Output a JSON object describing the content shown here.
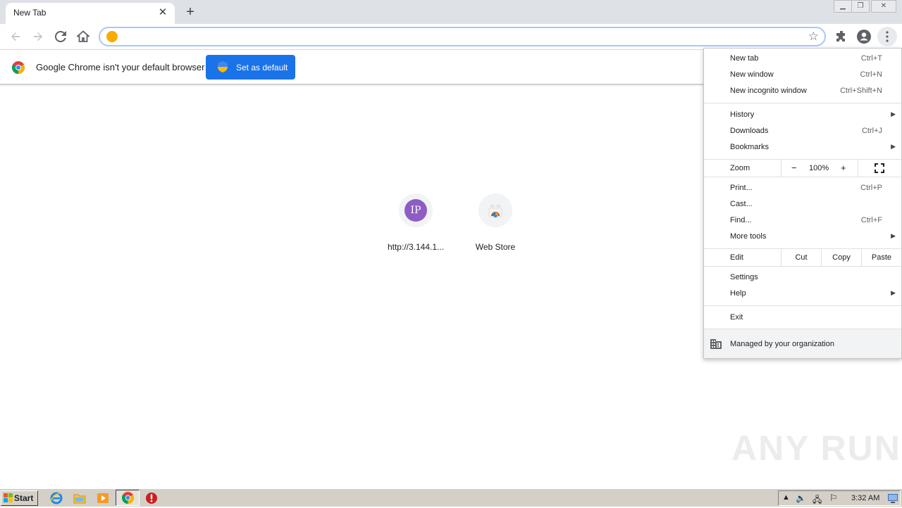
{
  "tab": {
    "title": "New Tab"
  },
  "omnibox": {
    "value": "",
    "placeholder": ""
  },
  "infobar": {
    "message": "Google Chrome isn't your default browser",
    "button_label": "Set as default"
  },
  "shortcuts": [
    {
      "label": "http://3.144.1...",
      "initials": "IP",
      "icon": "initials-avatar",
      "color": "#8e5cc4"
    },
    {
      "label": "Web Store",
      "icon": "web-store-icon"
    }
  ],
  "menu": {
    "new_tab": {
      "label": "New tab",
      "shortcut": "Ctrl+T"
    },
    "new_window": {
      "label": "New window",
      "shortcut": "Ctrl+N"
    },
    "new_incognito": {
      "label": "New incognito window",
      "shortcut": "Ctrl+Shift+N"
    },
    "history": {
      "label": "History"
    },
    "downloads": {
      "label": "Downloads",
      "shortcut": "Ctrl+J"
    },
    "bookmarks": {
      "label": "Bookmarks"
    },
    "zoom": {
      "label": "Zoom",
      "minus": "−",
      "value": "100%",
      "plus": "+"
    },
    "print": {
      "label": "Print...",
      "shortcut": "Ctrl+P"
    },
    "cast": {
      "label": "Cast..."
    },
    "find": {
      "label": "Find...",
      "shortcut": "Ctrl+F"
    },
    "more_tools": {
      "label": "More tools"
    },
    "edit": {
      "label": "Edit",
      "cut": "Cut",
      "copy": "Copy",
      "paste": "Paste"
    },
    "settings": {
      "label": "Settings"
    },
    "help": {
      "label": "Help"
    },
    "exit": {
      "label": "Exit"
    },
    "managed": {
      "label": "Managed by your organization"
    }
  },
  "watermark": "ANY RUN",
  "taskbar": {
    "start_label": "Start",
    "clock": "3:32 AM"
  },
  "colors": {
    "accent": "#1a73e8",
    "tab_strip": "#dee1e6",
    "taskbar": "#d4d0c8"
  }
}
